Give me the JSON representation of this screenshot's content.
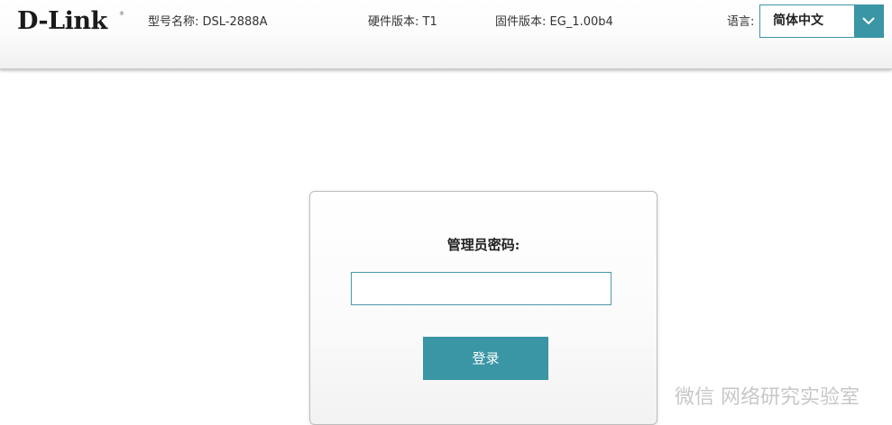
{
  "header": {
    "logo_text": "D-Link",
    "logo_registered": "®",
    "model_label": "型号名称: DSL-2888A",
    "hardware_label": "硬件版本: T1",
    "firmware_label": "固件版本: EG_1.00b4",
    "language_label": "语言:",
    "language_value": "简体中文",
    "accent_color": "#3a95a5"
  },
  "login": {
    "title": "管理员密码:",
    "password_value": "",
    "button_label": "登录"
  },
  "watermark": {
    "text": "微信 网络研究实验室"
  }
}
